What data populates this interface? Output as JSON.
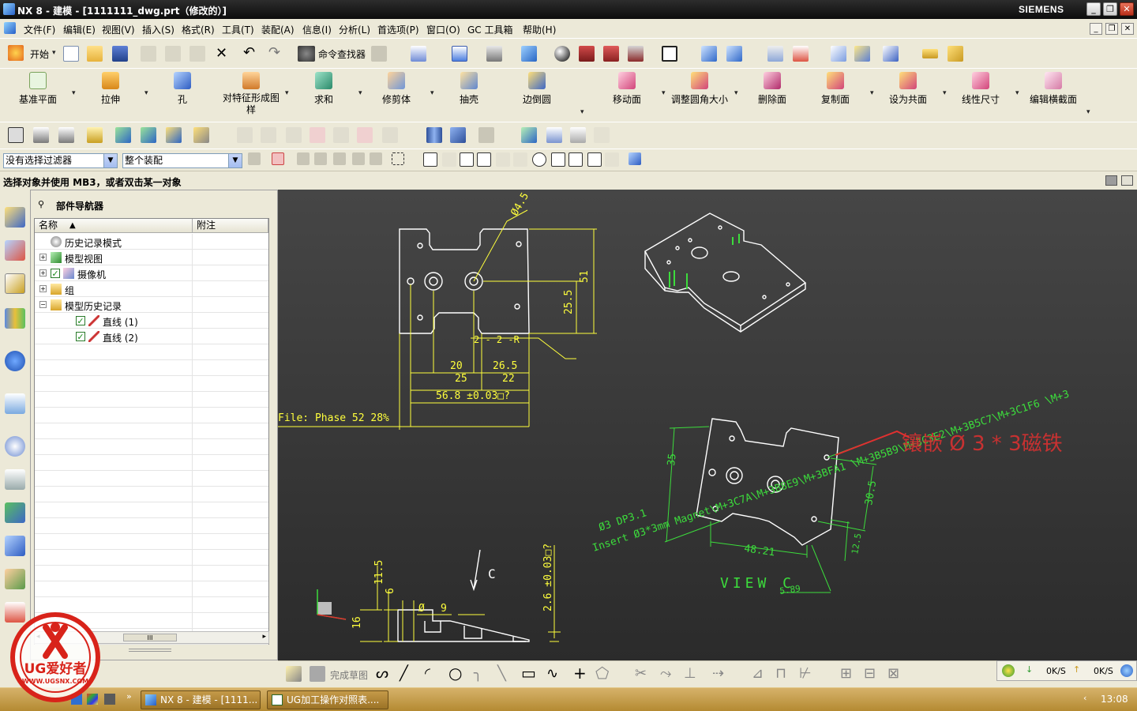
{
  "window": {
    "title": "NX 8 - 建模 - [1111111_dwg.prt（修改的）]",
    "brand": "SIEMENS",
    "controls": {
      "minimize": "_",
      "restore": "❐",
      "close": "✕"
    }
  },
  "menubar": {
    "items": [
      "文件(F)",
      "编辑(E)",
      "视图(V)",
      "插入(S)",
      "格式(R)",
      "工具(T)",
      "装配(A)",
      "信息(I)",
      "分析(L)",
      "首选项(P)",
      "窗口(O)",
      "GC 工具箱",
      "帮助(H)"
    ],
    "mdi": {
      "minimize": "_",
      "restore": "❐",
      "close": "✕"
    }
  },
  "standard_toolbar": {
    "start_label": "开始",
    "command_finder_label": "命令查找器"
  },
  "feature_toolbar": {
    "buttons": [
      "基准平面",
      "拉伸",
      "孔",
      "对特征形成图样",
      "求和",
      "修剪体",
      "抽壳",
      "边倒圆",
      "移动面",
      "调整圆角大小",
      "删除面",
      "复制面",
      "设为共面",
      "线性尺寸",
      "编辑横截面"
    ]
  },
  "selection_bar": {
    "filter_value": "没有选择过滤器",
    "scope_value": "整个装配"
  },
  "cue_line": "选择对象并使用 MB3，或者双击某一对象",
  "navigator": {
    "title": "部件导航器",
    "columns": [
      "名称",
      "附注"
    ],
    "rows": [
      {
        "label": "历史记录模式",
        "indent": 1,
        "expander": ""
      },
      {
        "label": "模型视图",
        "indent": 1,
        "expander": "+"
      },
      {
        "label": "摄像机",
        "indent": 1,
        "expander": "+"
      },
      {
        "label": "组",
        "indent": 1,
        "expander": "+"
      },
      {
        "label": "模型历史记录",
        "indent": 1,
        "expander": "-"
      },
      {
        "label": "直线 (1)",
        "indent": 2,
        "expander": ""
      },
      {
        "label": "直线 (2)",
        "indent": 2,
        "expander": ""
      }
    ],
    "scroll_thumb": "III"
  },
  "drawing": {
    "dim_phi45": "Ø4.5",
    "dim_51": "51",
    "dim_25_5": "25.5",
    "note_2r": "2 - 2 -R",
    "dim_20": "20",
    "dim_26_5": "26.5",
    "dim_25": "25",
    "dim_22": "22",
    "dim_56_8": "56.8 ±0.03□?",
    "file_note": "File: Phase 52 28%",
    "dim_35": "35",
    "dim_30_5": "30.5",
    "dim_48_21": "48.21",
    "dim_12_5": "12.5",
    "dim_5_89": "5.89",
    "view_c": "VIEW C",
    "note_phi3": "Ø3  DP3.1",
    "note_insert": "Insert Ø3*3mm Magnet\\M+3C7A\\M+3B8E9\\M+3BFA1 \\M+3B5B9\\M+3C3E2\\M+3B5C7\\M+3C1F6 \\M+3",
    "red_note": "镶嵌 Ø 3 * 3磁铁",
    "section_c": "C",
    "dim_11_5": "11.5",
    "dim_6": "6",
    "dim_phi_small": "Ø",
    "dim_9": "9",
    "dim_16": "16",
    "dim_2_6": "2.6 ±0.03□?"
  },
  "bottom_toolbar": {
    "finish_sketch": "完成草图"
  },
  "network": {
    "down": "0K/S",
    "up": "0K/S"
  },
  "taskbar": {
    "tasks": [
      "NX 8 - 建模 - [1111...",
      "UG加工操作对照表...."
    ],
    "clock": "13:08"
  },
  "watermark": {
    "text": "UG爱好者",
    "url": "WWW.UGSNX.COM"
  },
  "colors": {
    "accent_yellow": "#ffff3c",
    "dim_green": "#3cdc3c",
    "red_note": "#e03030",
    "canvas_bg": "#3a3a3a"
  }
}
